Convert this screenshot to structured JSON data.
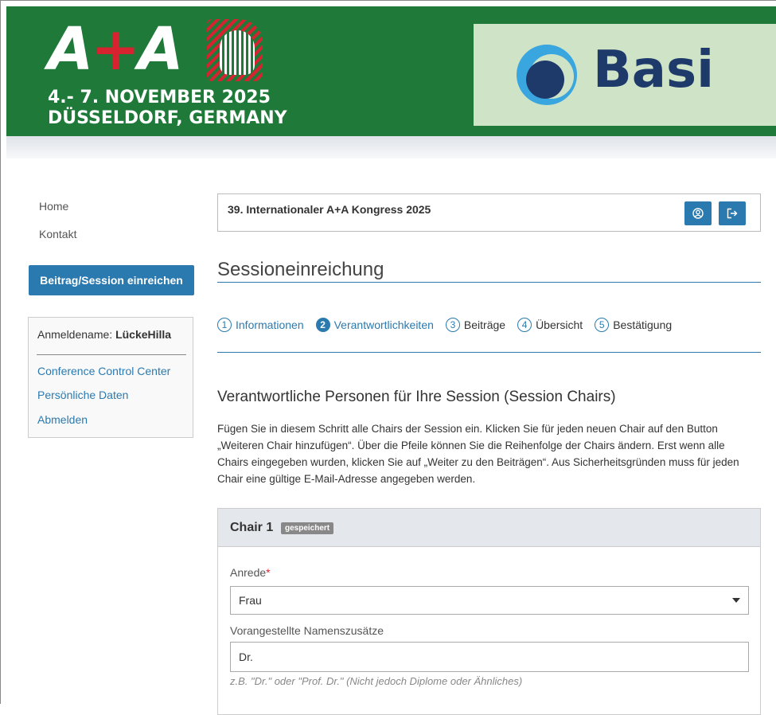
{
  "banner": {
    "logo_left": "A",
    "logo_plus": "+",
    "logo_right": "A",
    "date_line": "4.- 7. NOVEMBER 2025",
    "city_line": "DÜSSELDORF, GERMANY",
    "ad_text": "Basi",
    "colors": {
      "green": "#1f7a3a",
      "red": "#d7232f",
      "ad_bg": "#cfe3c6",
      "ad_text": "#1e3a6b"
    }
  },
  "nav": {
    "home": "Home",
    "contact": "Kontakt",
    "submit_button": "Beitrag/Session einreichen"
  },
  "user": {
    "login_label": "Anmeldename:",
    "login_name": "LückeHilla",
    "links": [
      "Conference Control Center",
      "Persönliche Daten",
      "Abmelden"
    ]
  },
  "congress": {
    "title": "39. Internationaler A+A Kongress 2025",
    "icons": [
      "user-profile-icon",
      "logout-icon"
    ]
  },
  "page": {
    "heading": "Sessioneinreichung",
    "steps": [
      {
        "num": "1",
        "label": "Informationen"
      },
      {
        "num": "2",
        "label": "Verantwortlichkeiten"
      },
      {
        "num": "3",
        "label": "Beiträge"
      },
      {
        "num": "4",
        "label": "Übersicht"
      },
      {
        "num": "5",
        "label": "Bestätigung"
      }
    ],
    "active_step": "2",
    "section_heading": "Verantwortliche Personen für Ihre Session (Session Chairs)",
    "description": "Fügen Sie in diesem Schritt alle Chairs der Session ein. Klicken Sie für jeden neuen Chair auf den Button „Weiteren Chair hinzufügen“. Über die Pfeile können Sie die Reihenfolge der Chairs ändern. Erst wenn alle Chairs eingegeben wurden, klicken Sie auf „Weiter zu den Beiträgen“. Aus Sicherheitsgründen muss für jeden Chair eine gültige E-Mail-Adresse angegeben werden."
  },
  "chair": {
    "title": "Chair 1",
    "badge": "gespeichert",
    "salutation_label": "Anrede",
    "required_mark": "*",
    "salutation_value": "Frau",
    "prefix_label": "Vorangestellte Namenszusätze",
    "prefix_value": "Dr.",
    "prefix_hint": "z.B. \"Dr.\" oder \"Prof. Dr.\" (Nicht jedoch Diplome oder Ähnliches)"
  },
  "colors": {
    "accent": "#2a7ab0",
    "badge": "#888888",
    "panel_head": "#e4e8ed"
  }
}
